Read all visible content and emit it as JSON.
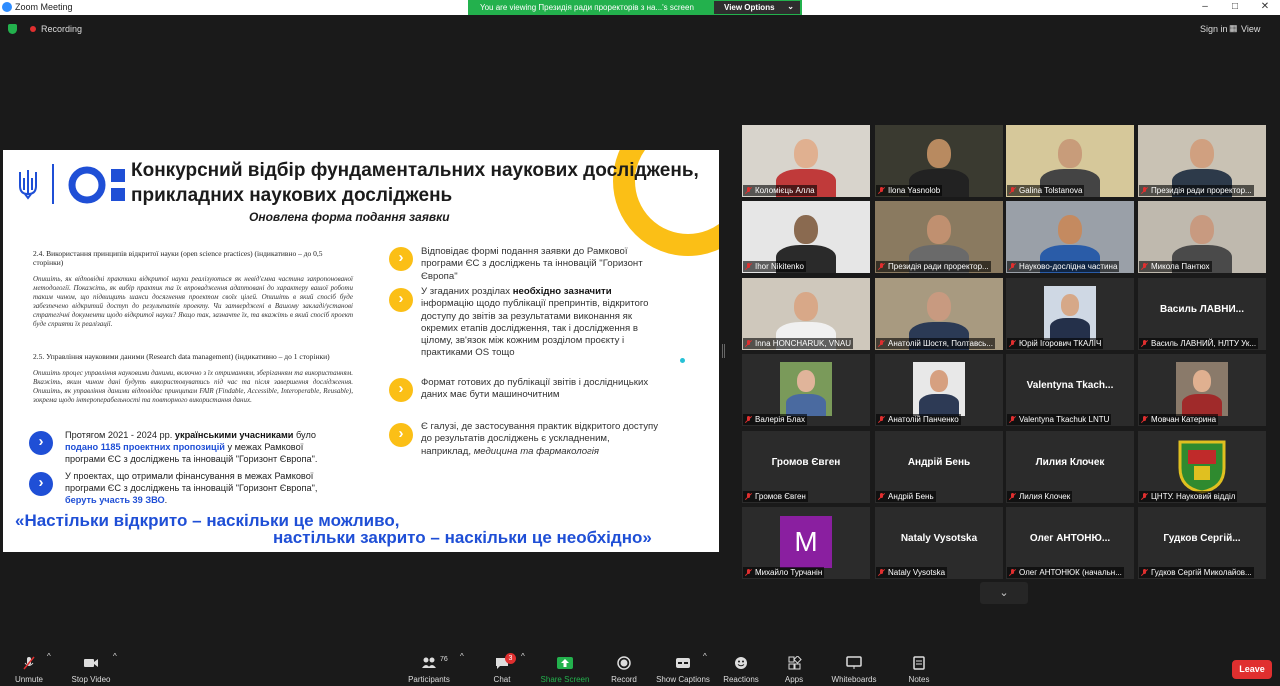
{
  "window": {
    "title": "Zoom Meeting",
    "controls": [
      "–",
      "□",
      "✕"
    ]
  },
  "share_banner": {
    "message": "You are viewing Президія ради проректорів з на...'s screen",
    "view_options": "View Options"
  },
  "topbar": {
    "recording": "Recording",
    "sign_in": "Sign in",
    "view": "View"
  },
  "slide": {
    "title": "Конкурсний відбір фундаментальних наукових досліджень, прикладних наукових досліджень",
    "subtitle": "Оновлена форма подання заявки",
    "doc": {
      "s24_heading": "2.4. Використання принципів відкритої науки (open science practices) (індикативно – до 0,5 сторінки)",
      "s24_body": "Опишіть, як відповідні практики відкритої науки реалізуються як невід'ємна частина запропонованої методології. Покажіть, як вибір практик та їх впровадження адаптовані до характеру вашої роботи таким чином, що підвищить шанси досягнення проектом своїх цілей. Опишіть в який спосіб буде забезпечено відкритий доступ до результатів проекту. Чи затверджені в Вашому закладі/установі стратегічні документи щодо відкритої науки? Якщо так, зазначте їх, та вкажіть в який спосіб проект буде сприяти їх реалізації.",
      "s25_heading": "2.5. Управління науковими даними (Research data management) (індикативно – до 1 сторінки)",
      "s25_body": "Опишіть процес управління науковими даними, включно з їх отриманням, зберіганням та використанням. Вкажіть, яким чином дані будуть використовуватись під час та після завершення дослідження. Опишіть, як управління даними відповідає принципам FAIR (Findable, Accessible, Interoperable, Reusable), зокрема щодо інтероперабельності та повторного використання даних."
    },
    "bullets_right": [
      {
        "text": "Відповідає формі подання заявки до Рамкової програми ЄС з досліджень та інновацій \"Горизонт Європа\""
      },
      {
        "pre": "У згаданих розділах ",
        "strong": "необхідно зазначити",
        "post": " інформацію щодо публікації препринтів, відкритого доступу до звітів за результатами виконання як окремих етапів дослідження, так і дослідження в цілому, зв'язок між кожним розділом проєкту і практиками OS тощо"
      },
      {
        "text": "Формат готових до публікації звітів і дослідницьких даних має бути машиночитним"
      },
      {
        "pre": "Є галузі, де застосування практик відкритого доступу до результатів досліджень є ускладненим, наприклад, ",
        "italic": "медицина та фармакологія"
      }
    ],
    "bullets_left": [
      {
        "p1": "Протягом 2021 - 2024 рр. ",
        "s1": "українськими учасниками",
        "p2": " було ",
        "h1": "подано 1185 проектних пропозицій",
        "p3": " у межах Рамкової програми ЄС з досліджень та інновацій \"Горизонт Європа\"."
      },
      {
        "p1": "У проектах, що отримали фінансування в межах Рамкової програми ЄС з досліджень та інновацій \"Горизонт Європа\", ",
        "h1": "беруть участь 39 ЗВО",
        "p2": "."
      }
    ],
    "quote_line1": "«Настільки відкрито – наскільки це можливо,",
    "quote_line2": "настільки закрито – наскільки це необхідно»",
    "arrow_glyph": "›"
  },
  "participants": [
    {
      "label": "Коломієць Алла",
      "type": "video",
      "bg": "#d8d4cc",
      "skin": "#e0b090",
      "shirt": "#c03a3a"
    },
    {
      "label": "Ilona Yasnolob",
      "type": "video",
      "bg": "#3a3a30",
      "skin": "#b88a60",
      "shirt": "#222"
    },
    {
      "label": "Galina Tolstanova",
      "type": "video",
      "bg": "#d6c89a",
      "skin": "#c89c7a",
      "shirt": "#444",
      "active": true
    },
    {
      "label": "Президія ради проректор...",
      "type": "video",
      "bg": "#c9c2b4",
      "skin": "#d0a080",
      "shirt": "#2d3a4a"
    },
    {
      "label": "Ihor Nikitenko",
      "type": "video",
      "bg": "#e6e6e6",
      "skin": "#8a6a50",
      "shirt": "#2a2a2a"
    },
    {
      "label": "Президія ради проректор...",
      "type": "video",
      "bg": "#8a7a60",
      "skin": "#c09070",
      "shirt": "#6a6a6a"
    },
    {
      "label": "Науково-дослідна частина",
      "type": "video",
      "bg": "#9aa0a8",
      "skin": "#c48a60",
      "shirt": "#2a5ca8"
    },
    {
      "label": "Микола Пантюх",
      "type": "video",
      "bg": "#bfb9ae",
      "skin": "#c89a80",
      "shirt": "#4a4a4a"
    },
    {
      "label": "Inna HONCHARUK, VNAU",
      "type": "video",
      "bg": "#cfc8bc",
      "skin": "#d8a888",
      "shirt": "#f0f0f0"
    },
    {
      "label": "Анатолій Шостя, Полтавсь...",
      "type": "video",
      "bg": "#a89a80",
      "skin": "#c89a80",
      "shirt": "#2b3a55"
    },
    {
      "label": "Юрій Ігорович ТКАЛІЧ",
      "type": "photo",
      "bg": "#2b2b2b",
      "photo_bg": "#cfd8e4",
      "skin": "#d6a888",
      "shirt": "#24304a"
    },
    {
      "label": "Василь ЛАВНИЙ, НЛТУ Ук...",
      "type": "name",
      "name": "Василь ЛАВНИ..."
    },
    {
      "label": "Валерія Блах",
      "type": "photo",
      "bg": "#2b2b2b",
      "photo_bg": "#7a9a5a",
      "skin": "#e0b49a",
      "shirt": "#4a6aa0"
    },
    {
      "label": "Анатолій Панченко",
      "type": "photo",
      "bg": "#2b2b2b",
      "photo_bg": "#e8e8e8",
      "skin": "#d6a080",
      "shirt": "#2d3a55"
    },
    {
      "label": "Valentyna Tkachuk LNTU",
      "type": "name",
      "name": "Valentyna  Tkach..."
    },
    {
      "label": "Мовчан Катерина",
      "type": "photo",
      "bg": "#2b2b2b",
      "photo_bg": "#8a7a6a",
      "skin": "#e0b090",
      "shirt": "#a02a2a"
    },
    {
      "label": "Громов Євген",
      "type": "name",
      "name": "Громов Євген"
    },
    {
      "label": "Андрій Бень",
      "type": "name",
      "name": "Андрій Бень"
    },
    {
      "label": "Лилия Клочек",
      "type": "name",
      "name": "Лилия Клочек"
    },
    {
      "label": "ЦНТУ. Науковий відділ",
      "type": "emblem",
      "bg": "#2b2b2b"
    },
    {
      "label": "Михайло Турчанін",
      "type": "initial",
      "initial": "M",
      "color": "#8a1fa0"
    },
    {
      "label": "Nataly Vysotska",
      "type": "name",
      "name": "Nataly Vysotska"
    },
    {
      "label": "Олег АНТОНЮК (начальн...",
      "type": "name",
      "name": "Олег  АНТОНЮ..."
    },
    {
      "label": "Гудков Сергій Миколайов...",
      "type": "name",
      "name": "Гудков  Сергій..."
    }
  ],
  "toolbar": {
    "unmute": "Unmute",
    "stop_video": "Stop Video",
    "participants": "Participants",
    "participants_count": "76",
    "chat": "Chat",
    "chat_badge": "3",
    "share_screen": "Share Screen",
    "record": "Record",
    "show_captions": "Show Captions",
    "reactions": "Reactions",
    "apps": "Apps",
    "whiteboards": "Whiteboards",
    "notes": "Notes",
    "leave": "Leave",
    "caret": "^",
    "scroll_down": "⌄"
  },
  "colors": {
    "accent_blue": "#1f4fd6",
    "accent_yellow": "#fbbf16",
    "share_green": "#23b14d",
    "leave_red": "#e02f2f",
    "active_speaker": "#d6e35c"
  }
}
